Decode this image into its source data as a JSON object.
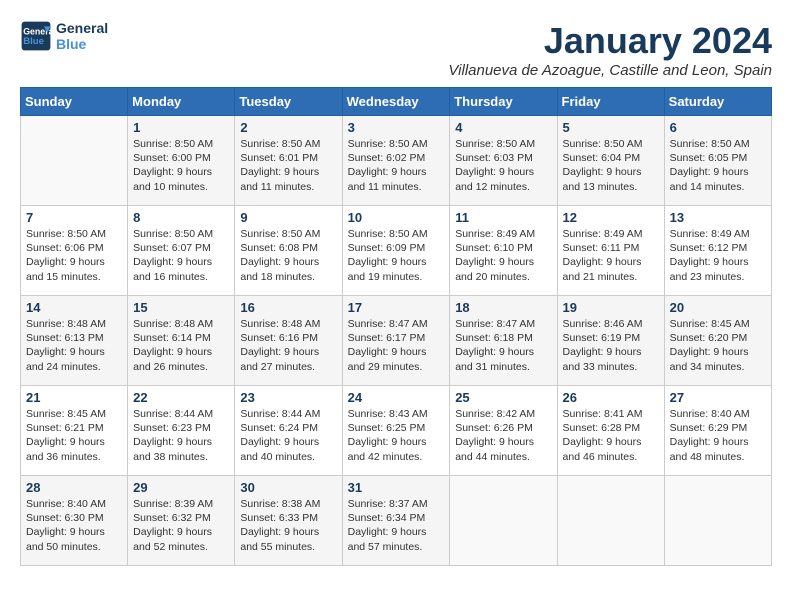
{
  "logo": {
    "line1": "General",
    "line2": "Blue"
  },
  "title": "January 2024",
  "subtitle": "Villanueva de Azoague, Castille and Leon, Spain",
  "weekdays": [
    "Sunday",
    "Monday",
    "Tuesday",
    "Wednesday",
    "Thursday",
    "Friday",
    "Saturday"
  ],
  "weeks": [
    [
      {
        "day": "",
        "info": ""
      },
      {
        "day": "1",
        "info": "Sunrise: 8:50 AM\nSunset: 6:00 PM\nDaylight: 9 hours\nand 10 minutes."
      },
      {
        "day": "2",
        "info": "Sunrise: 8:50 AM\nSunset: 6:01 PM\nDaylight: 9 hours\nand 11 minutes."
      },
      {
        "day": "3",
        "info": "Sunrise: 8:50 AM\nSunset: 6:02 PM\nDaylight: 9 hours\nand 11 minutes."
      },
      {
        "day": "4",
        "info": "Sunrise: 8:50 AM\nSunset: 6:03 PM\nDaylight: 9 hours\nand 12 minutes."
      },
      {
        "day": "5",
        "info": "Sunrise: 8:50 AM\nSunset: 6:04 PM\nDaylight: 9 hours\nand 13 minutes."
      },
      {
        "day": "6",
        "info": "Sunrise: 8:50 AM\nSunset: 6:05 PM\nDaylight: 9 hours\nand 14 minutes."
      }
    ],
    [
      {
        "day": "7",
        "info": "Sunrise: 8:50 AM\nSunset: 6:06 PM\nDaylight: 9 hours\nand 15 minutes."
      },
      {
        "day": "8",
        "info": "Sunrise: 8:50 AM\nSunset: 6:07 PM\nDaylight: 9 hours\nand 16 minutes."
      },
      {
        "day": "9",
        "info": "Sunrise: 8:50 AM\nSunset: 6:08 PM\nDaylight: 9 hours\nand 18 minutes."
      },
      {
        "day": "10",
        "info": "Sunrise: 8:50 AM\nSunset: 6:09 PM\nDaylight: 9 hours\nand 19 minutes."
      },
      {
        "day": "11",
        "info": "Sunrise: 8:49 AM\nSunset: 6:10 PM\nDaylight: 9 hours\nand 20 minutes."
      },
      {
        "day": "12",
        "info": "Sunrise: 8:49 AM\nSunset: 6:11 PM\nDaylight: 9 hours\nand 21 minutes."
      },
      {
        "day": "13",
        "info": "Sunrise: 8:49 AM\nSunset: 6:12 PM\nDaylight: 9 hours\nand 23 minutes."
      }
    ],
    [
      {
        "day": "14",
        "info": "Sunrise: 8:48 AM\nSunset: 6:13 PM\nDaylight: 9 hours\nand 24 minutes."
      },
      {
        "day": "15",
        "info": "Sunrise: 8:48 AM\nSunset: 6:14 PM\nDaylight: 9 hours\nand 26 minutes."
      },
      {
        "day": "16",
        "info": "Sunrise: 8:48 AM\nSunset: 6:16 PM\nDaylight: 9 hours\nand 27 minutes."
      },
      {
        "day": "17",
        "info": "Sunrise: 8:47 AM\nSunset: 6:17 PM\nDaylight: 9 hours\nand 29 minutes."
      },
      {
        "day": "18",
        "info": "Sunrise: 8:47 AM\nSunset: 6:18 PM\nDaylight: 9 hours\nand 31 minutes."
      },
      {
        "day": "19",
        "info": "Sunrise: 8:46 AM\nSunset: 6:19 PM\nDaylight: 9 hours\nand 33 minutes."
      },
      {
        "day": "20",
        "info": "Sunrise: 8:45 AM\nSunset: 6:20 PM\nDaylight: 9 hours\nand 34 minutes."
      }
    ],
    [
      {
        "day": "21",
        "info": "Sunrise: 8:45 AM\nSunset: 6:21 PM\nDaylight: 9 hours\nand 36 minutes."
      },
      {
        "day": "22",
        "info": "Sunrise: 8:44 AM\nSunset: 6:23 PM\nDaylight: 9 hours\nand 38 minutes."
      },
      {
        "day": "23",
        "info": "Sunrise: 8:44 AM\nSunset: 6:24 PM\nDaylight: 9 hours\nand 40 minutes."
      },
      {
        "day": "24",
        "info": "Sunrise: 8:43 AM\nSunset: 6:25 PM\nDaylight: 9 hours\nand 42 minutes."
      },
      {
        "day": "25",
        "info": "Sunrise: 8:42 AM\nSunset: 6:26 PM\nDaylight: 9 hours\nand 44 minutes."
      },
      {
        "day": "26",
        "info": "Sunrise: 8:41 AM\nSunset: 6:28 PM\nDaylight: 9 hours\nand 46 minutes."
      },
      {
        "day": "27",
        "info": "Sunrise: 8:40 AM\nSunset: 6:29 PM\nDaylight: 9 hours\nand 48 minutes."
      }
    ],
    [
      {
        "day": "28",
        "info": "Sunrise: 8:40 AM\nSunset: 6:30 PM\nDaylight: 9 hours\nand 50 minutes."
      },
      {
        "day": "29",
        "info": "Sunrise: 8:39 AM\nSunset: 6:32 PM\nDaylight: 9 hours\nand 52 minutes."
      },
      {
        "day": "30",
        "info": "Sunrise: 8:38 AM\nSunset: 6:33 PM\nDaylight: 9 hours\nand 55 minutes."
      },
      {
        "day": "31",
        "info": "Sunrise: 8:37 AM\nSunset: 6:34 PM\nDaylight: 9 hours\nand 57 minutes."
      },
      {
        "day": "",
        "info": ""
      },
      {
        "day": "",
        "info": ""
      },
      {
        "day": "",
        "info": ""
      }
    ]
  ]
}
